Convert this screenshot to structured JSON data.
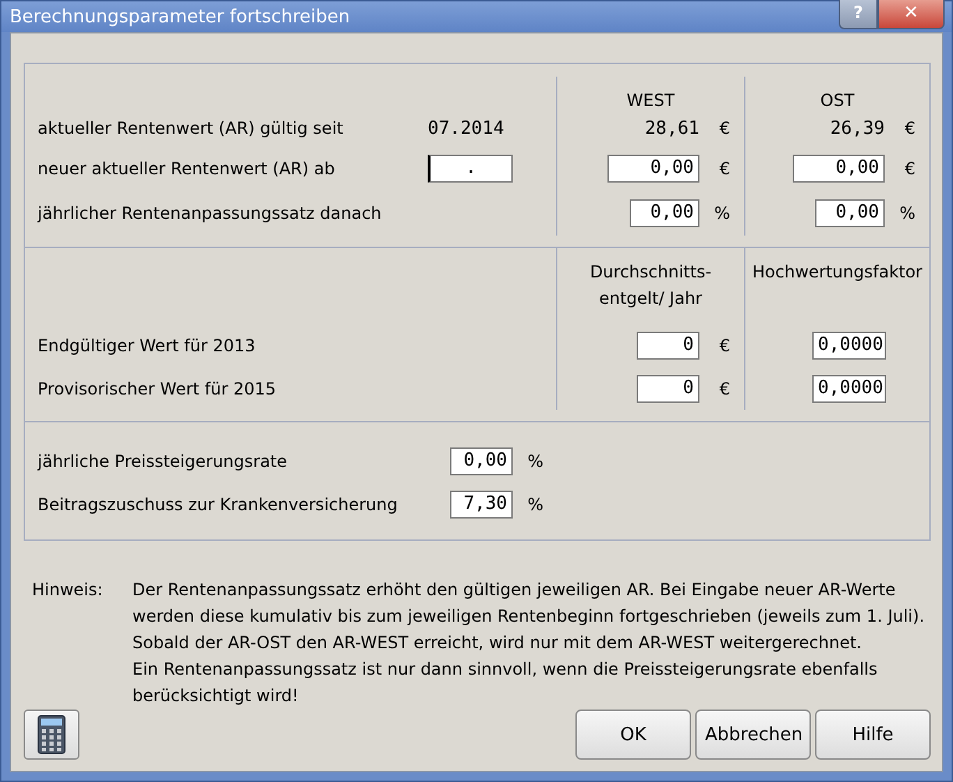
{
  "window": {
    "title": "Berechnungsparameter fortschreiben",
    "help": "?",
    "close": "✕"
  },
  "ar_section": {
    "columns": [
      "WEST",
      "OST"
    ],
    "rows": [
      {
        "kind": "display",
        "label": "aktueller Rentenwert (AR) gültig seit",
        "date": "07.2014",
        "west": {
          "value": "28,61",
          "unit": "€"
        },
        "ost": {
          "value": "26,39",
          "unit": "€"
        }
      },
      {
        "kind": "input",
        "label": "neuer aktueller Rentenwert (AR) ab",
        "date": ".",
        "west": {
          "value": "0,00",
          "unit": "€"
        },
        "ost": {
          "value": "0,00",
          "unit": "€"
        }
      },
      {
        "kind": "input",
        "label": "jährlicher Rentenanpassungssatz danach",
        "west": {
          "value": "0,00",
          "unit": "%"
        },
        "ost": {
          "value": "0,00",
          "unit": "%"
        }
      }
    ]
  },
  "wage_section": {
    "columns": [
      "Durchschnitts-\nentgelt/ Jahr",
      "Hochwertungsfaktor"
    ],
    "rows": [
      {
        "label": "Endgültiger Wert für 2013",
        "average": {
          "value": "0",
          "unit": "€"
        },
        "factor": "0,0000"
      },
      {
        "label": "Provisorischer Wert für 2015",
        "average": {
          "value": "0",
          "unit": "€"
        },
        "factor": "0,0000"
      }
    ]
  },
  "rate_section": {
    "rows": [
      {
        "label": "jährliche Preissteigerungsrate",
        "value": "0,00",
        "unit": "%"
      },
      {
        "label": "Beitragszuschuss zur Krankenversicherung",
        "value": "7,30",
        "unit": "%"
      }
    ]
  },
  "hint": {
    "label": "Hinweis:",
    "lines": [
      "Der Rentenanpassungssatz erhöht den gültigen jeweiligen AR. Bei Eingabe neuer AR-Werte",
      "werden diese kumulativ bis zum jeweiligen Rentenbeginn fortgeschrieben (jeweils zum 1. Juli).",
      "Sobald der AR-OST den AR-WEST erreicht, wird nur mit dem AR-WEST weitergerechnet.",
      "Ein Rentenanpassungssatz ist nur dann sinnvoll, wenn die Preissteigerungsrate ebenfalls",
      "berücksichtigt wird!"
    ]
  },
  "buttons": [
    "OK",
    "Abbrechen",
    "Hilfe"
  ]
}
